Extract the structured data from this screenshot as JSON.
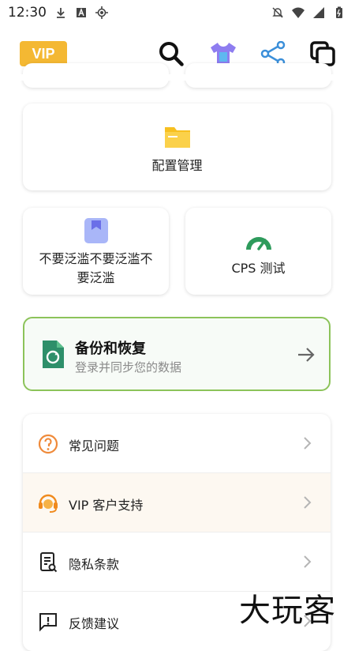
{
  "status_bar": {
    "time": "12:30",
    "left_icons": [
      "download-icon",
      "a-square-icon",
      "location-crosshair-icon"
    ],
    "right_icons": [
      "notifications-off-icon",
      "wifi-icon",
      "signal-icon",
      "battery-icon"
    ]
  },
  "top_bar": {
    "vip_label": "VIP",
    "icons": [
      "search-icon",
      "tshirt-icon",
      "share-nodes-icon",
      "copy-icon"
    ]
  },
  "tiles": {
    "config": {
      "label": "配置管理",
      "icon": "folder-icon"
    },
    "nospam": {
      "label_line1": "不要泛滥不要泛滥不",
      "label_line2": "要泛滥",
      "icon": "bookmark-icon"
    },
    "cps": {
      "label": "CPS 测试",
      "icon": "speedometer-icon"
    }
  },
  "backup": {
    "title": "备份和恢复",
    "subtitle": "登录并同步您的数据",
    "icon": "sync-document-icon"
  },
  "menu": {
    "items": [
      {
        "label": "常见问题",
        "icon": "question-circle-icon"
      },
      {
        "label": "VIP 客户支持",
        "icon": "headset-support-icon"
      },
      {
        "label": "隐私条款",
        "icon": "privacy-document-icon"
      },
      {
        "label": "反馈建议",
        "icon": "feedback-message-icon"
      }
    ]
  },
  "watermark": "大玩客",
  "colors": {
    "vip": "#f4b833",
    "accent_green": "#8cc35a",
    "folder_yellow": "#f7c020",
    "gauge_green": "#2e9b5c"
  }
}
